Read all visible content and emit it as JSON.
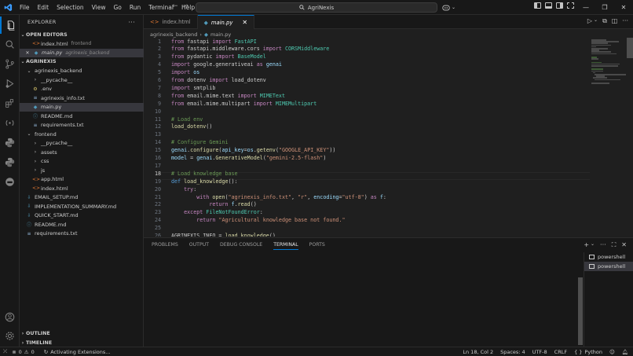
{
  "titlebar": {
    "menu": [
      "File",
      "Edit",
      "Selection",
      "View",
      "Go",
      "Run",
      "Terminal",
      "Help"
    ],
    "search_text": "AgriNexis"
  },
  "sidebar": {
    "title": "EXPLORER",
    "open_editors_label": "OPEN EDITORS",
    "open_editors": [
      {
        "name": "index.html",
        "folder": "frontend"
      },
      {
        "name": "main.py",
        "folder": "agrinexis_backend"
      }
    ],
    "root_label": "AGRINEXIS",
    "tree": [
      {
        "label": "agrinexis_backend",
        "type": "folder-open",
        "depth": 1
      },
      {
        "label": "__pycache__",
        "type": "folder",
        "depth": 2
      },
      {
        "label": ".env",
        "type": "env",
        "depth": 2
      },
      {
        "label": "agrinexis_info.txt",
        "type": "txt",
        "depth": 2
      },
      {
        "label": "main.py",
        "type": "py",
        "depth": 2
      },
      {
        "label": "README.md",
        "type": "info",
        "depth": 2
      },
      {
        "label": "requirements.txt",
        "type": "txt",
        "depth": 2
      },
      {
        "label": "frontend",
        "type": "folder-open",
        "depth": 1
      },
      {
        "label": "__pycache__",
        "type": "folder",
        "depth": 2
      },
      {
        "label": "assets",
        "type": "folder",
        "depth": 2
      },
      {
        "label": "css",
        "type": "folder",
        "depth": 2
      },
      {
        "label": "js",
        "type": "folder",
        "depth": 2
      },
      {
        "label": "app.html",
        "type": "html",
        "depth": 2
      },
      {
        "label": "index.html",
        "type": "html",
        "depth": 2
      },
      {
        "label": "EMAIL_SETUP.md",
        "type": "md",
        "depth": 1
      },
      {
        "label": "IMPLEMENTATION_SUMMARY.md",
        "type": "md",
        "depth": 1
      },
      {
        "label": "QUICK_START.md",
        "type": "md",
        "depth": 1
      },
      {
        "label": "README.md",
        "type": "info",
        "depth": 1
      },
      {
        "label": "requirements.txt",
        "type": "txt",
        "depth": 1
      }
    ],
    "outline_label": "OUTLINE",
    "timeline_label": "TIMELINE"
  },
  "tabs": [
    {
      "label": "index.html"
    },
    {
      "label": "main.py"
    }
  ],
  "breadcrumb": [
    "agrinexis_backend",
    "main.py"
  ],
  "editor": {
    "current_line": 18,
    "lines": [
      "from fastapi import FastAPI",
      "from fastapi.middleware.cors import CORSMiddleware",
      "from pydantic import BaseModel",
      "import google.generativeai as genai",
      "import os",
      "from dotenv import load_dotenv",
      "import smtplib",
      "from email.mime.text import MIMEText",
      "from email.mime.multipart import MIMEMultipart",
      "",
      "# Load env",
      "load_dotenv()",
      "",
      "# Configure Gemini",
      "genai.configure(api_key=os.getenv(\"GOOGLE_API_KEY\"))",
      "model = genai.GenerativeModel(\"gemini-2.5-flash\")",
      "",
      "# Load knowledge base",
      "def load_knowledge():",
      "    try:",
      "        with open(\"agrinexis_info.txt\", \"r\", encoding=\"utf-8\") as f:",
      "            return f.read()",
      "    except FileNotFoundError:",
      "        return \"Agricultural knowledge base not found.\"",
      "",
      "AGRINEXIS_INFO = load_knowledge()"
    ]
  },
  "panel": {
    "tabs": [
      "PROBLEMS",
      "OUTPUT",
      "DEBUG CONSOLE",
      "TERMINAL",
      "PORTS"
    ],
    "active_tab": "TERMINAL",
    "terminals": [
      "powershell",
      "powershell"
    ]
  },
  "statusbar": {
    "errors": "0",
    "warnings": "0",
    "activity": "Activating Extensions...",
    "position": "Ln 18, Col 2",
    "spaces": "Spaces: 4",
    "encoding": "UTF-8",
    "eol": "CRLF",
    "language": "Python",
    "language_braces": "{ }"
  },
  "colors": {
    "accent": "#0078d4",
    "background": "#1f1f1f",
    "chrome": "#181818"
  }
}
